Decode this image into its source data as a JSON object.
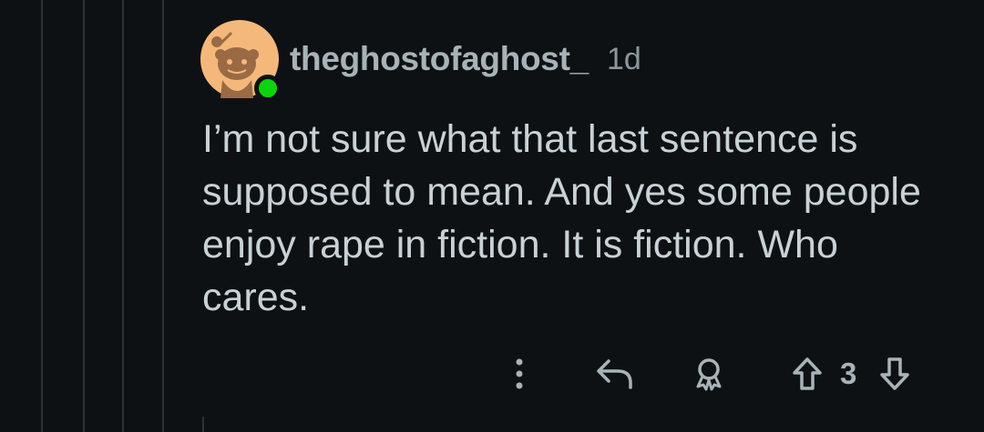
{
  "comment": {
    "username": "theghostofaghost_",
    "timestamp": "1d",
    "body": "I’m not sure what that last sentence is supposed to mean. And yes some people enjoy rape in fiction. It is fiction. Who cares.",
    "online": true
  },
  "actions": {
    "more_icon": "more-vertical-icon",
    "reply_icon": "reply-icon",
    "award_icon": "award-icon",
    "upvote_icon": "upvote-icon",
    "vote_count": "3",
    "downvote_icon": "downvote-icon"
  },
  "colors": {
    "background": "#0e1114",
    "online_indicator": "#0dd30d",
    "avatar_background": "#f4b87a"
  }
}
